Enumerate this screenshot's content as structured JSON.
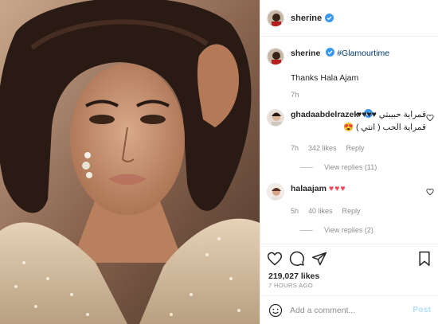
{
  "post": {
    "username": "sherine",
    "image_alt": "portrait photo"
  },
  "caption": {
    "username": "sherine",
    "hashtag": "#Glamourtime",
    "text": "Thanks Hala Ajam",
    "time": "7h"
  },
  "comments": [
    {
      "username": "ghadaabdelrazek",
      "line1": "قمراية حبيبتي ♥♥♥♥",
      "line2": "قمراية الحب ( انتي ) 😍",
      "time": "7h",
      "likes": "342 likes",
      "reply": "Reply",
      "view_replies": "View replies (11)"
    },
    {
      "username": "halaajam",
      "hearts": "♥♥♥",
      "time": "5h",
      "likes": "40 likes",
      "reply": "Reply",
      "view_replies": "View replies (2)"
    }
  ],
  "stats": {
    "likes": "219,027 likes",
    "ago": "7 HOURS AGO"
  },
  "add_comment": {
    "placeholder": "Add a comment...",
    "post_label": "Post"
  },
  "colors": {
    "link": "#00376b",
    "verified": "#3897f0",
    "heart": "#ed4956",
    "post_disabled": "#b2dffc"
  }
}
